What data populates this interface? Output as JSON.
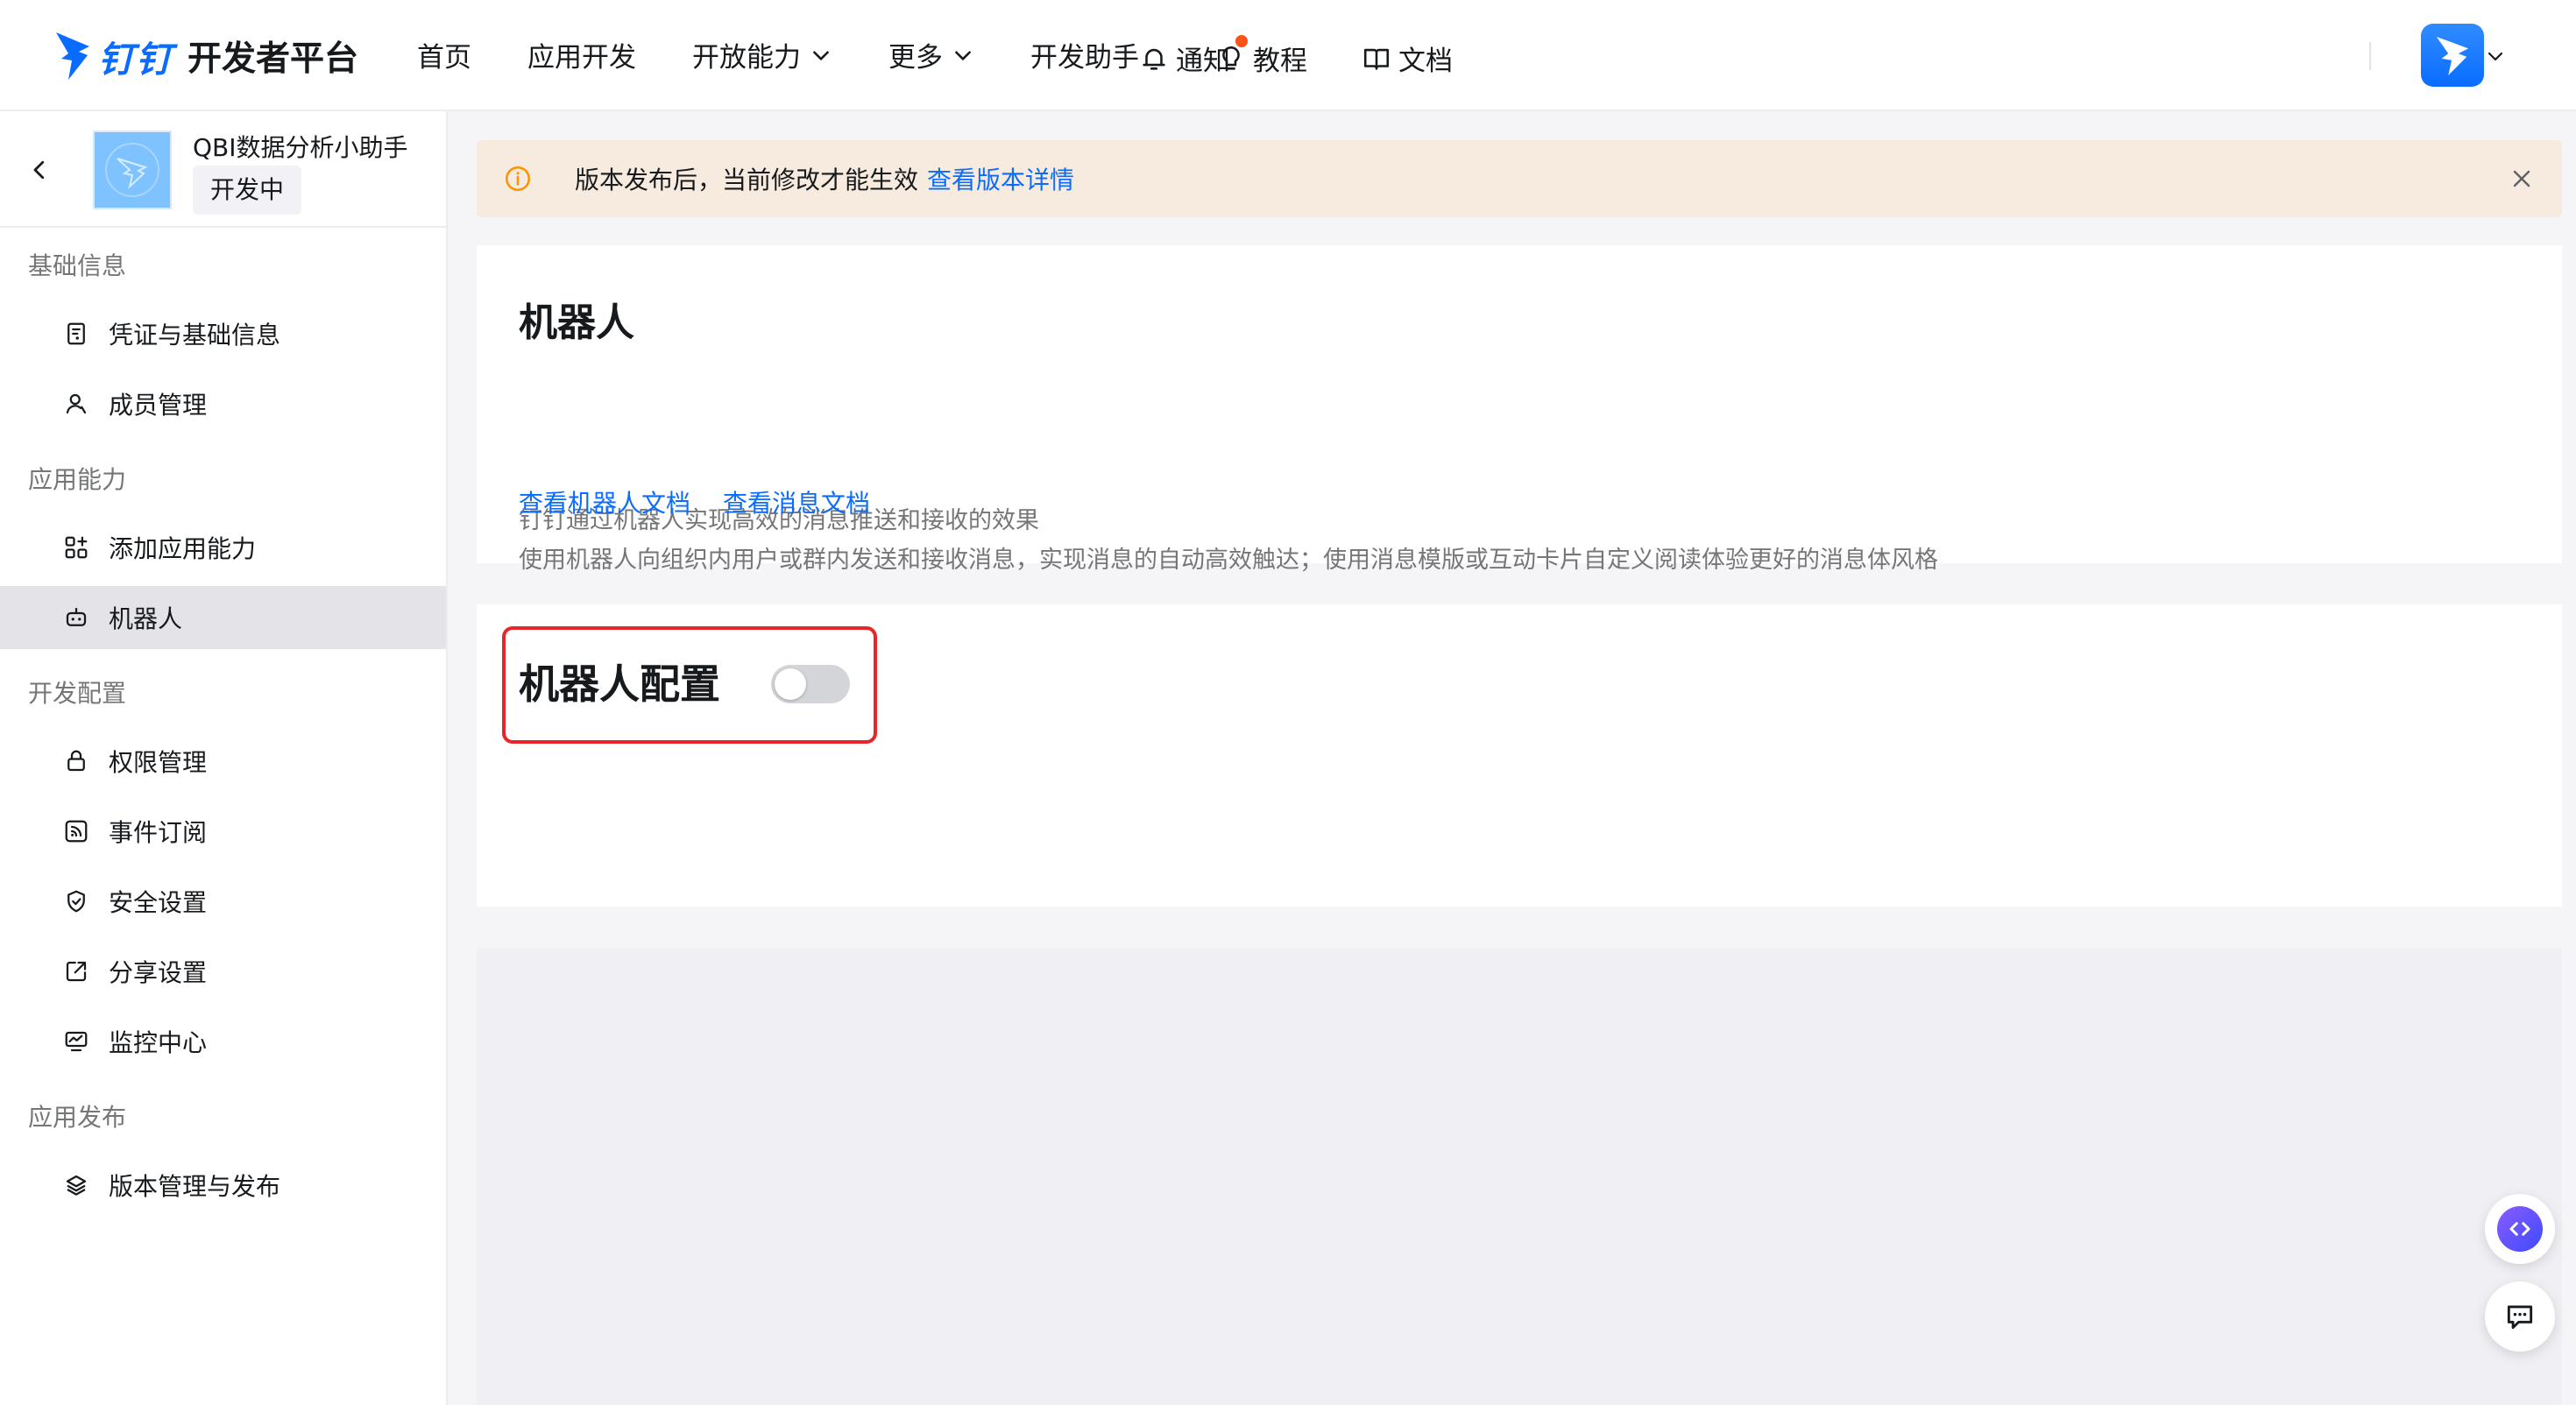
{
  "header": {
    "logo_cn": "钉钉",
    "logo_title": "开发者平台",
    "nav": [
      {
        "label": "首页"
      },
      {
        "label": "应用开发"
      },
      {
        "label": "开放能力"
      },
      {
        "label": "更多"
      },
      {
        "label": "开发助手"
      }
    ],
    "notify_label": "通知",
    "tutorial_label": "教程",
    "docs_label": "文档"
  },
  "sidebar": {
    "app_name": "QBI数据分析小助手",
    "app_status": "开发中",
    "groups": [
      {
        "label": "基础信息",
        "items": [
          {
            "label": "凭证与基础信息",
            "icon": "credential-icon"
          },
          {
            "label": "成员管理",
            "icon": "member-icon"
          }
        ]
      },
      {
        "label": "应用能力",
        "items": [
          {
            "label": "添加应用能力",
            "icon": "add-capability-icon"
          },
          {
            "label": "机器人",
            "icon": "robot-icon",
            "active": true
          }
        ]
      },
      {
        "label": "开发配置",
        "items": [
          {
            "label": "权限管理",
            "icon": "lock-icon"
          },
          {
            "label": "事件订阅",
            "icon": "rss-icon"
          },
          {
            "label": "安全设置",
            "icon": "shield-icon"
          },
          {
            "label": "分享设置",
            "icon": "share-icon"
          },
          {
            "label": "监控中心",
            "icon": "monitor-icon"
          }
        ]
      },
      {
        "label": "应用发布",
        "items": [
          {
            "label": "版本管理与发布",
            "icon": "layers-icon"
          }
        ]
      }
    ]
  },
  "notice": {
    "text": "版本发布后，当前修改才能生效",
    "link": "查看版本详情"
  },
  "intro": {
    "title": "机器人",
    "desc1": "钉钉通过机器人实现高效的消息推送和接收的效果",
    "desc2": "使用机器人向组织内用户或群内发送和接收消息，实现消息的自动高效触达；使用消息模版或互动卡片自定义阅读体验更好的消息体风格",
    "link_robot_doc": "查看机器人文档",
    "link_message_doc": "查看消息文档"
  },
  "config": {
    "title": "机器人配置",
    "enabled": false
  },
  "colors": {
    "brand": "#0a6cff",
    "highlight": "#e8262a",
    "notice_bg": "#f7ebdf",
    "notice_icon": "#ff9200"
  }
}
